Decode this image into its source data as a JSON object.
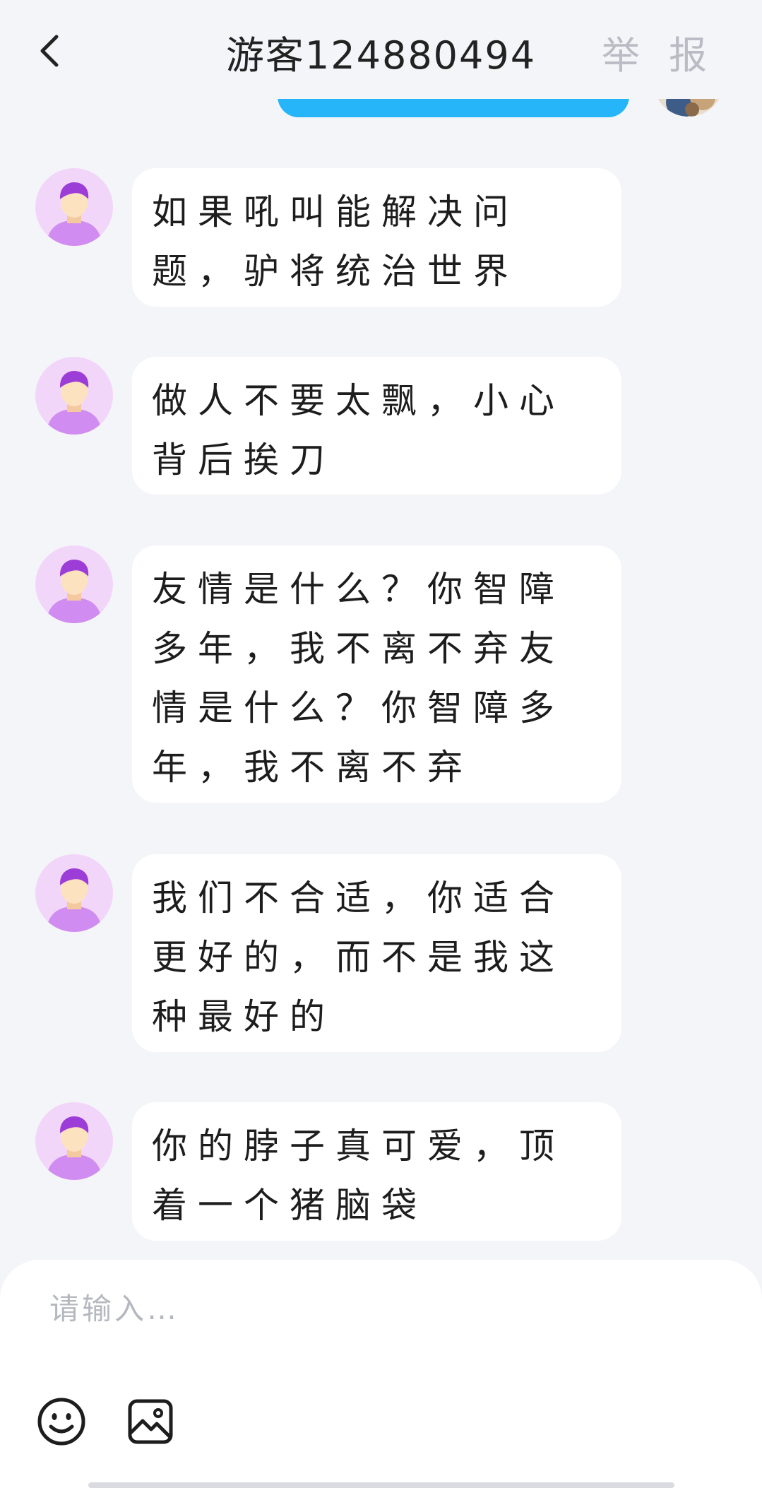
{
  "header": {
    "title": "游客124880494",
    "report_label": "举 报"
  },
  "messages": [
    {
      "text": "如果吼叫能解决问题，驴将统治世界"
    },
    {
      "text": "做人不要太飘，小心背后挨刀"
    },
    {
      "text": "友情是什么？你智障多年，我不离不弃友情是什么？你智障多年，我不离不弃"
    },
    {
      "text": "我们不合适，你适合更好的，而不是我这种最好的"
    },
    {
      "text": "你的脖子真可爱，顶着一个猪脑袋"
    }
  ],
  "composer": {
    "placeholder": "请输入…",
    "value": ""
  },
  "icons": {
    "back": "chevron-left-icon",
    "emoji": "smiley-icon",
    "image": "image-icon"
  },
  "colors": {
    "sent_bubble": "#26b5f8",
    "avatar_bg": "#f2d6fa",
    "report": "#b9bcc4"
  }
}
